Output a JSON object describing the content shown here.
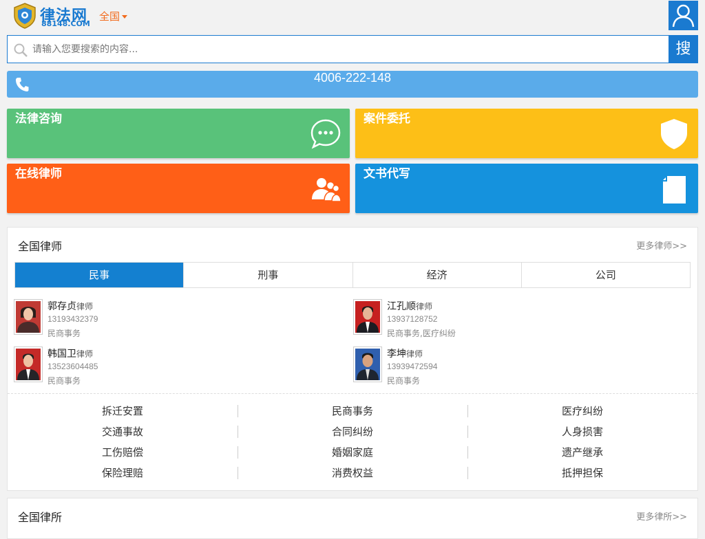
{
  "brand": {
    "logo_text": "律法网",
    "logo_sub": "88148.COM"
  },
  "header": {
    "region": "全国"
  },
  "search": {
    "placeholder": "请输入您要搜索的内容...",
    "button_label": "搜"
  },
  "hotline": {
    "number": "4006-222-148"
  },
  "tiles": [
    {
      "label": "法律咨询",
      "color": "#59c27a",
      "icon": "chat-bubble-icon"
    },
    {
      "label": "案件委托",
      "color": "#fdbf17",
      "icon": "shield-icon"
    },
    {
      "label": "在线律师",
      "color": "#ff5f17",
      "icon": "users-icon"
    },
    {
      "label": "文书代写",
      "color": "#1592dd",
      "icon": "document-icon"
    }
  ],
  "lawyers_section": {
    "title": "全国律师",
    "more": "更多律师>>",
    "tabs": [
      "民事",
      "刑事",
      "经济",
      "公司"
    ],
    "lawyers": [
      {
        "name": "郭存贞",
        "suffix": "律师",
        "phone": "13193432379",
        "specialty": "民商事务"
      },
      {
        "name": "江孔顺",
        "suffix": "律师",
        "phone": "13937128752",
        "specialty": "民商事务,医疗纠纷"
      },
      {
        "name": "韩国卫",
        "suffix": "律师",
        "phone": "13523604485",
        "specialty": "民商事务"
      },
      {
        "name": "李坤",
        "suffix": "律师",
        "phone": "13939472594",
        "specialty": "民商事务"
      }
    ],
    "categories": [
      [
        "拆迁安置",
        "民商事务",
        "医疗纠纷"
      ],
      [
        "交通事故",
        "合同纠纷",
        "人身损害"
      ],
      [
        "工伤赔偿",
        "婚姻家庭",
        "遗产继承"
      ],
      [
        "保险理赔",
        "消费权益",
        "抵押担保"
      ]
    ]
  },
  "firms_section": {
    "title": "全国律所",
    "more": "更多律所>>"
  },
  "colors": {
    "primary": "#1a7ad0",
    "accent": "#f26b1d",
    "hotline_bg": "#5aabea",
    "tab_active": "#1480d0"
  }
}
